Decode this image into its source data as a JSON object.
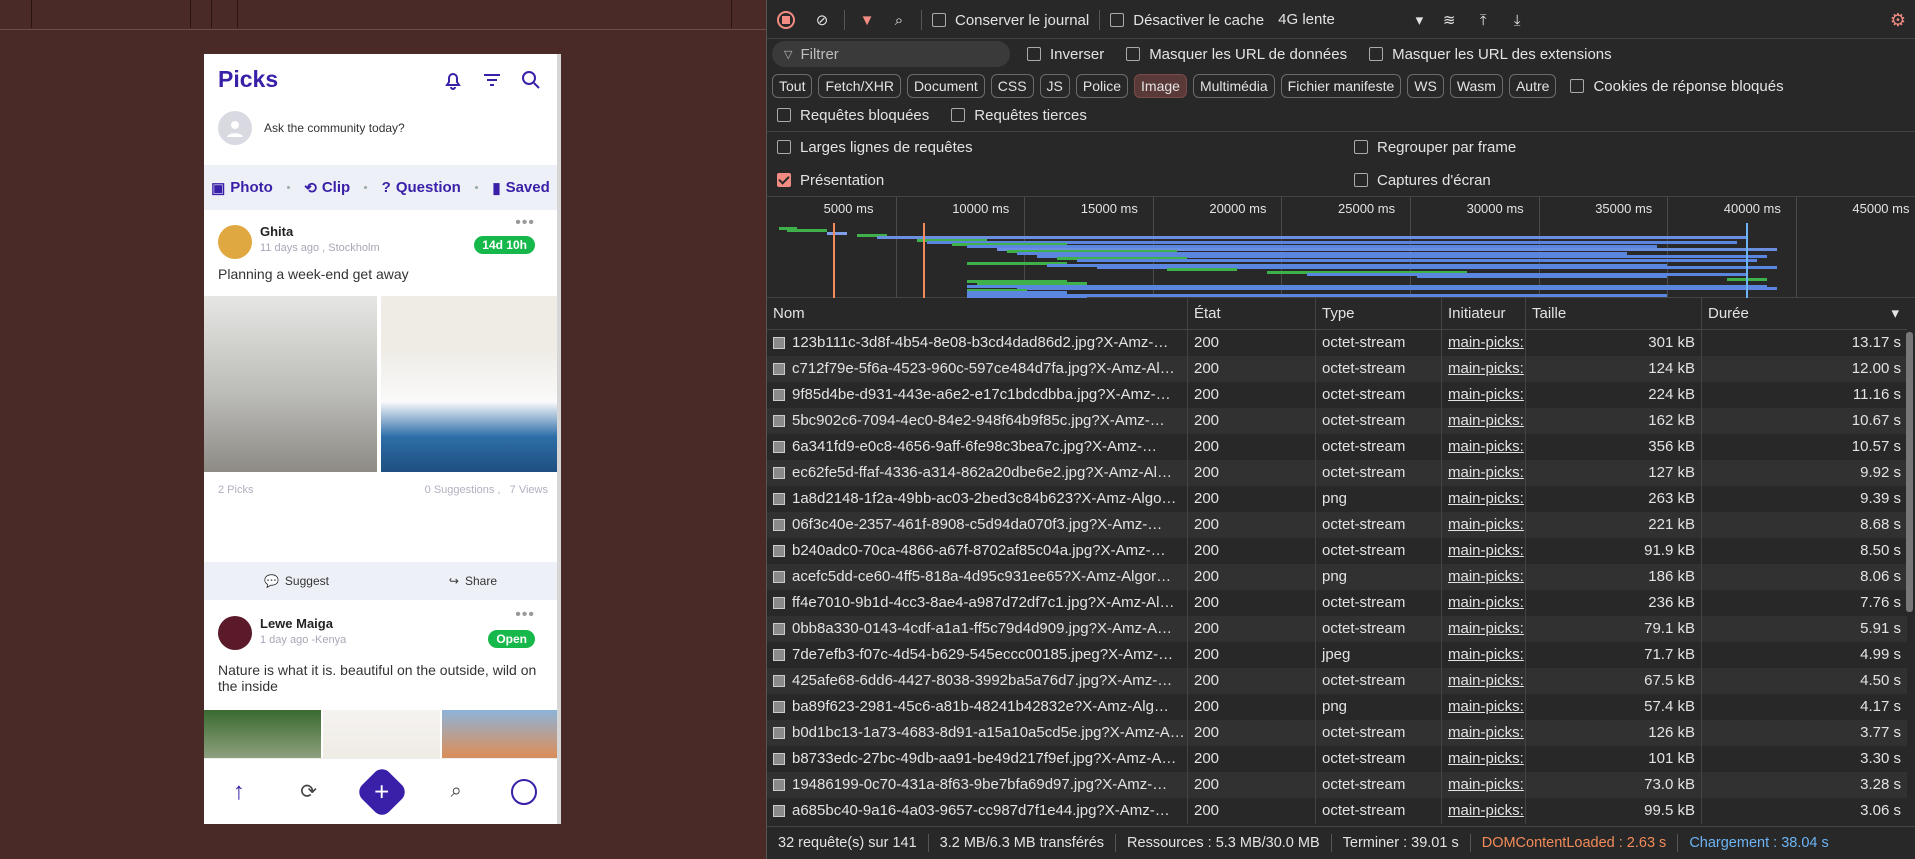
{
  "phone": {
    "title": "Picks",
    "ask_placeholder": "Ask the community today?",
    "actions": [
      {
        "label": "Photo",
        "icon": "photo-icon"
      },
      {
        "label": "Clip",
        "icon": "clip-icon"
      },
      {
        "label": "Question",
        "icon": "question-icon"
      },
      {
        "label": "Saved",
        "icon": "bookmark-icon"
      }
    ],
    "post1": {
      "name": "Ghita",
      "meta": "11 days ago , Stockholm",
      "badge": "14d 10h",
      "text": "Planning a week-end get away",
      "picks": "2 Picks",
      "suggestions": "0 Suggestions ,",
      "views": "7 Views",
      "suggest": "Suggest",
      "share": "Share"
    },
    "post2": {
      "name": "Lewe Maiga",
      "meta": "1 day ago -Kenya",
      "badge": "Open",
      "text": "Nature is what it is. beautiful on the outside, wild on the inside"
    }
  },
  "devtools": {
    "toolbar": {
      "preserve_log": "Conserver le journal",
      "disable_cache": "Désactiver le cache",
      "throttling": "4G lente"
    },
    "filter": {
      "placeholder": "Filtrer",
      "invert": "Inverser",
      "hide_data_urls": "Masquer les URL de données",
      "hide_ext_urls": "Masquer les URL des extensions"
    },
    "types": [
      "Tout",
      "Fetch/XHR",
      "Document",
      "CSS",
      "JS",
      "Police",
      "Image",
      "Multimédia",
      "Fichier manifeste",
      "WS",
      "Wasm",
      "Autre"
    ],
    "selected_type": "Image",
    "blocked_cookies": "Cookies de réponse bloqués",
    "blocked_requests": "Requêtes bloquées",
    "third_party": "Requêtes tierces",
    "big_rows": "Larges lignes de requêtes",
    "group_frame": "Regrouper par frame",
    "overview": "Présentation",
    "screenshots": "Captures d'écran",
    "timeline_ticks": [
      "5000 ms",
      "10000 ms",
      "15000 ms",
      "20000 ms",
      "25000 ms",
      "30000 ms",
      "35000 ms",
      "40000 ms",
      "45000 ms"
    ],
    "columns": [
      "Nom",
      "État",
      "Type",
      "Initiateur",
      "Taille",
      "Durée"
    ],
    "rows": [
      [
        "123b111c-3d8f-4b54-8e08-b3cd4dad86d2.jpg?X-Amz-…",
        "200",
        "octet-stream",
        "main-picks:",
        "301 kB",
        "13.17 s"
      ],
      [
        "c712f79e-5f6a-4523-960c-597ce484d7fa.jpg?X-Amz-Al…",
        "200",
        "octet-stream",
        "main-picks:",
        "124 kB",
        "12.00 s"
      ],
      [
        "9f85d4be-d931-443e-a6e2-e17c1bdcdbba.jpg?X-Amz-…",
        "200",
        "octet-stream",
        "main-picks:",
        "224 kB",
        "11.16 s"
      ],
      [
        "5bc902c6-7094-4ec0-84e2-948f64b9f85c.jpg?X-Amz-…",
        "200",
        "octet-stream",
        "main-picks:",
        "162 kB",
        "10.67 s"
      ],
      [
        "6a341fd9-e0c8-4656-9aff-6fe98c3bea7c.jpg?X-Amz-…",
        "200",
        "octet-stream",
        "main-picks:",
        "356 kB",
        "10.57 s"
      ],
      [
        "ec62fe5d-ffaf-4336-a314-862a20dbe6e2.jpg?X-Amz-Al…",
        "200",
        "octet-stream",
        "main-picks:",
        "127 kB",
        "9.92 s"
      ],
      [
        "1a8d2148-1f2a-49bb-ac03-2bed3c84b623?X-Amz-Algo…",
        "200",
        "png",
        "main-picks:",
        "263 kB",
        "9.39 s"
      ],
      [
        "06f3c40e-2357-461f-8908-c5d94da070f3.jpg?X-Amz-…",
        "200",
        "octet-stream",
        "main-picks:",
        "221 kB",
        "8.68 s"
      ],
      [
        "b240adc0-70ca-4866-a67f-8702af85c04a.jpg?X-Amz-…",
        "200",
        "octet-stream",
        "main-picks:",
        "91.9 kB",
        "8.50 s"
      ],
      [
        "acefc5dd-ce60-4ff5-818a-4d95c931ee65?X-Amz-Algor…",
        "200",
        "png",
        "main-picks:",
        "186 kB",
        "8.06 s"
      ],
      [
        "ff4e7010-9b1d-4cc3-8ae4-a987d72df7c1.jpg?X-Amz-Al…",
        "200",
        "octet-stream",
        "main-picks:",
        "236 kB",
        "7.76 s"
      ],
      [
        "0bb8a330-0143-4cdf-a1a1-ff5c79d4d909.jpg?X-Amz-A…",
        "200",
        "octet-stream",
        "main-picks:",
        "79.1 kB",
        "5.91 s"
      ],
      [
        "7de7efb3-f07c-4d54-b629-545eccc00185.jpeg?X-Amz-…",
        "200",
        "jpeg",
        "main-picks:",
        "71.7 kB",
        "4.99 s"
      ],
      [
        "425afe68-6dd6-4427-8038-3992ba5a76d7.jpg?X-Amz-…",
        "200",
        "octet-stream",
        "main-picks:",
        "67.5 kB",
        "4.50 s"
      ],
      [
        "ba89f623-2981-45c6-a81b-48241b42832e?X-Amz-Alg…",
        "200",
        "png",
        "main-picks:",
        "57.4 kB",
        "4.17 s"
      ],
      [
        "b0d1bc13-1a73-4683-8d91-a15a10a5cd5e.jpg?X-Amz-A…",
        "200",
        "octet-stream",
        "main-picks:",
        "126 kB",
        "3.77 s"
      ],
      [
        "b8733edc-27bc-49db-aa91-be49d217f9ef.jpg?X-Amz-A…",
        "200",
        "octet-stream",
        "main-picks:",
        "101 kB",
        "3.30 s"
      ],
      [
        "19486199-0c70-431a-8f63-9be7bfa69d97.jpg?X-Amz-…",
        "200",
        "octet-stream",
        "main-picks:",
        "73.0 kB",
        "3.28 s"
      ],
      [
        "a685bc40-9a16-4a03-9657-cc987d7f1e44.jpg?X-Amz-…",
        "200",
        "octet-stream",
        "main-picks:",
        "99.5 kB",
        "3.06 s"
      ]
    ],
    "status": {
      "requests": "32 requête(s) sur 141",
      "transferred": "3.2 MB/6.3 MB transférés",
      "resources": "Ressources : 5.3 MB/30.0 MB",
      "finish": "Terminer : 39.01 s",
      "dcl": "DOMContentLoaded : 2.63 s",
      "load": "Chargement : 38.04 s"
    },
    "colors": {
      "dcl": "#f28b59",
      "load": "#6cb4f5",
      "accent": "#f28b82"
    }
  }
}
